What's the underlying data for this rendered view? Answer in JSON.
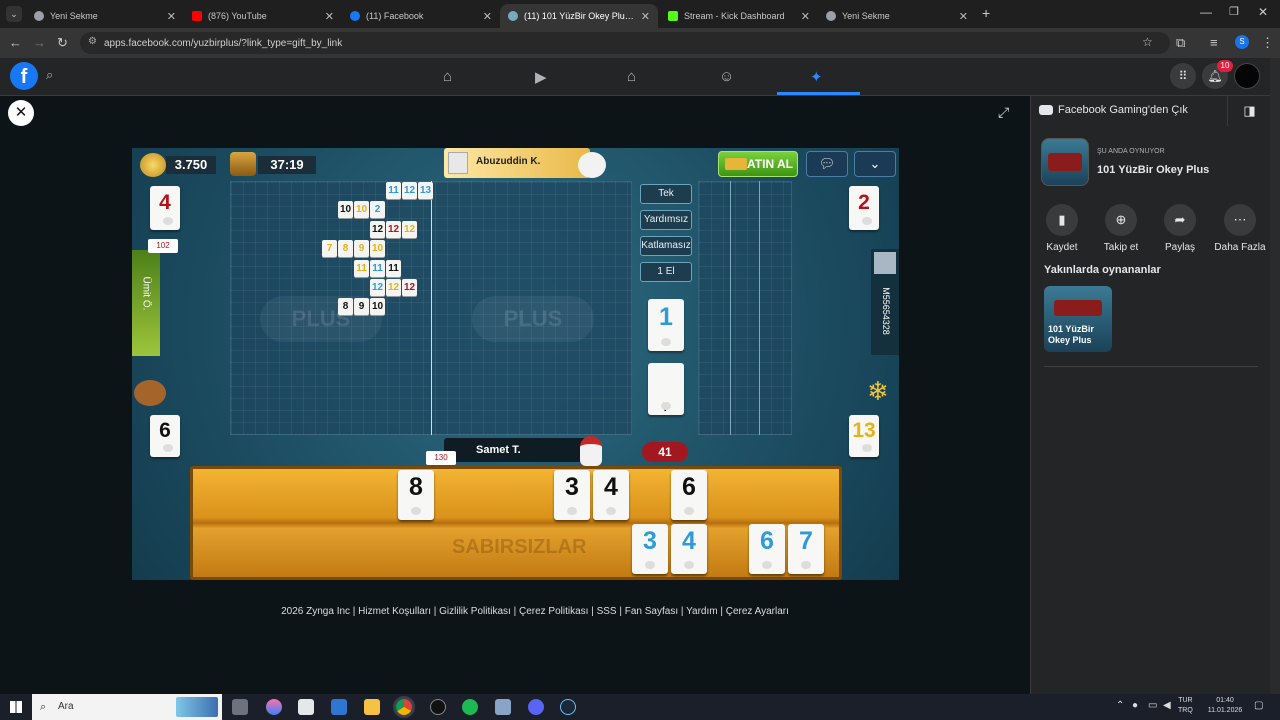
{
  "browser": {
    "tabs": [
      {
        "title": "Yeni Sekme"
      },
      {
        "title": "(876) YouTube"
      },
      {
        "title": "(11) Facebook"
      },
      {
        "title": "(11) 101 YüzBir Okey Plus | Face"
      },
      {
        "title": "Stream - Kick Dashboard"
      },
      {
        "title": "Yeni Sekme"
      }
    ],
    "url": "apps.facebook.com/yuzbirplus/?link_type=gift_by_link",
    "profile_initial": "S"
  },
  "fbnav": {
    "notification_count": "10"
  },
  "game": {
    "coins": "3.750",
    "timer": "37:19",
    "top_player": "Abuzuddin K.",
    "buy_button": "SATIN AL",
    "left_indicator": "4",
    "right_indicator": "2",
    "left_discard": "6",
    "right_discard": "13",
    "left_player": "Ümit Ö.",
    "right_player": "M55654328",
    "left_small": "102",
    "bottom_small": "130",
    "bottom_player": "Samet T.",
    "score": "41",
    "modes": [
      "Tek",
      "Yardımsız",
      "Katlamasız",
      "1 El"
    ],
    "center_tile": "1",
    "deck_count": "7",
    "melds": [
      [
        [
          "11",
          "blue"
        ],
        [
          "12",
          "blue"
        ],
        [
          "13",
          "blue"
        ]
      ],
      [
        [
          "10",
          "black"
        ],
        [
          "10",
          "yellow"
        ],
        [
          "2",
          "blue"
        ]
      ],
      [
        [
          "12",
          "black"
        ],
        [
          "12",
          "red"
        ],
        [
          "12",
          "yellow"
        ]
      ],
      [
        [
          "7",
          "yellow"
        ],
        [
          "8",
          "yellow"
        ],
        [
          "9",
          "yellow"
        ],
        [
          "10",
          "yellow"
        ]
      ],
      [
        [
          "11",
          "yellow"
        ],
        [
          "11",
          "blue"
        ],
        [
          "11",
          "black"
        ]
      ],
      [
        [
          "12",
          "blue"
        ],
        [
          "12",
          "yellow"
        ],
        [
          "12",
          "red"
        ]
      ],
      [
        [
          "8",
          "black"
        ],
        [
          "9",
          "black"
        ],
        [
          "10",
          "black"
        ]
      ]
    ],
    "rack_top": [
      [
        "8",
        "black"
      ],
      [
        "3",
        "black"
      ],
      [
        "4",
        "black"
      ],
      [
        "6",
        "black"
      ]
    ],
    "rack_bottom": [
      [
        "3",
        "blue"
      ],
      [
        "4",
        "blue"
      ],
      [
        "6",
        "blue"
      ],
      [
        "7",
        "blue"
      ]
    ],
    "footer": "2026 Zynga Inc | Hizmet Koşulları | Gizlilik Politikası | Çerez Politikası | SSS | Fan Sayfası | Yardım | Çerez Ayarları"
  },
  "sidebar": {
    "exit_label": "Facebook Gaming'den Çık",
    "now_playing_label": "ŞU ANDA OYNUYOR",
    "game_title": "101 YüzBir Okey Plus",
    "actions": [
      {
        "label": "Kaydet",
        "icon": "bookmark-icon"
      },
      {
        "label": "Takip et",
        "icon": "follow-icon"
      },
      {
        "label": "Paylaş",
        "icon": "share-icon"
      },
      {
        "label": "Daha Fazla",
        "icon": "more-icon"
      }
    ],
    "recent_label": "Yakınlarda oynananlar",
    "recent_game": "101 YüzBir Okey Plus"
  },
  "taskbar": {
    "search_placeholder": "Ara",
    "lang_top": "TUR",
    "lang_bottom": "TRQ",
    "time": "01:40",
    "date": "11.01.2026"
  },
  "colors": {
    "fb_blue": "#1877f2",
    "gold": "#e8b53b",
    "felt": "#1d4e63"
  }
}
